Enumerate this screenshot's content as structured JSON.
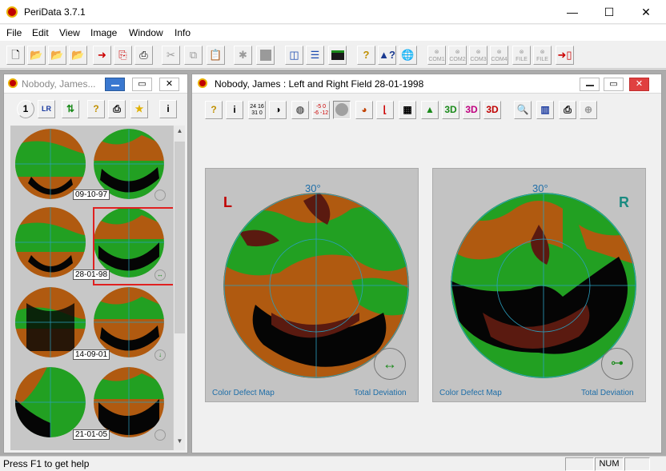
{
  "app": {
    "title": "PeriData 3.7.1"
  },
  "window_controls": {
    "minimize": "—",
    "maximize": "☐",
    "close": "✕"
  },
  "menu": [
    "File",
    "Edit",
    "View",
    "Image",
    "Window",
    "Info"
  ],
  "toolbar": {
    "icons": [
      "new-icon",
      "open-icon",
      "open-green-icon",
      "open-gray-icon",
      "import-icon",
      "export-icon",
      "print-icon",
      "cut-icon",
      "copy-icon",
      "paste-icon",
      "bug-icon",
      "stop-icon",
      "tile-vertical-icon",
      "tile-horizontal-icon",
      "monitor-icon",
      "help-icon",
      "context-help-icon",
      "web-icon",
      "com1-icon",
      "com2-icon",
      "com3-icon",
      "com4-icon",
      "file1-icon",
      "file2-icon",
      "exit-icon"
    ],
    "labels": {
      "com1": "COM1",
      "com2": "COM2",
      "com3": "COM3",
      "com4": "COM4",
      "file1": "FILE",
      "file2": "FILE"
    }
  },
  "left_window": {
    "title": "Nobody, James...",
    "toolbar": {
      "b1": "1",
      "b2": "LR",
      "b6": "i"
    },
    "thumbnails": [
      {
        "date": "09-10-97"
      },
      {
        "date": "28-01-98"
      },
      {
        "date": "14-09-01"
      },
      {
        "date": "21-01-05"
      }
    ]
  },
  "right_window": {
    "title": "Nobody, James :  Left and Right Field 28-01-1998",
    "toolbar": {
      "ticks": "24 16\n31 0",
      "dev": "-5 0\n-6 -12",
      "info": "i"
    },
    "left_field": {
      "eye": "L",
      "angle": "30°",
      "caption_left": "Color Defect Map",
      "caption_right": "Total Deviation"
    },
    "right_field": {
      "eye": "R",
      "angle": "30°",
      "caption_left": "Color Defect Map",
      "caption_right": "Total Deviation"
    }
  },
  "colors": {
    "green": "#22a022",
    "brown": "#b05a10",
    "dark": "#5a1a10",
    "black": "#050505",
    "eye_L": "#c00000",
    "eye_R": "#1a8a80"
  },
  "status": {
    "help": "Press F1 to get help",
    "num": "NUM"
  }
}
